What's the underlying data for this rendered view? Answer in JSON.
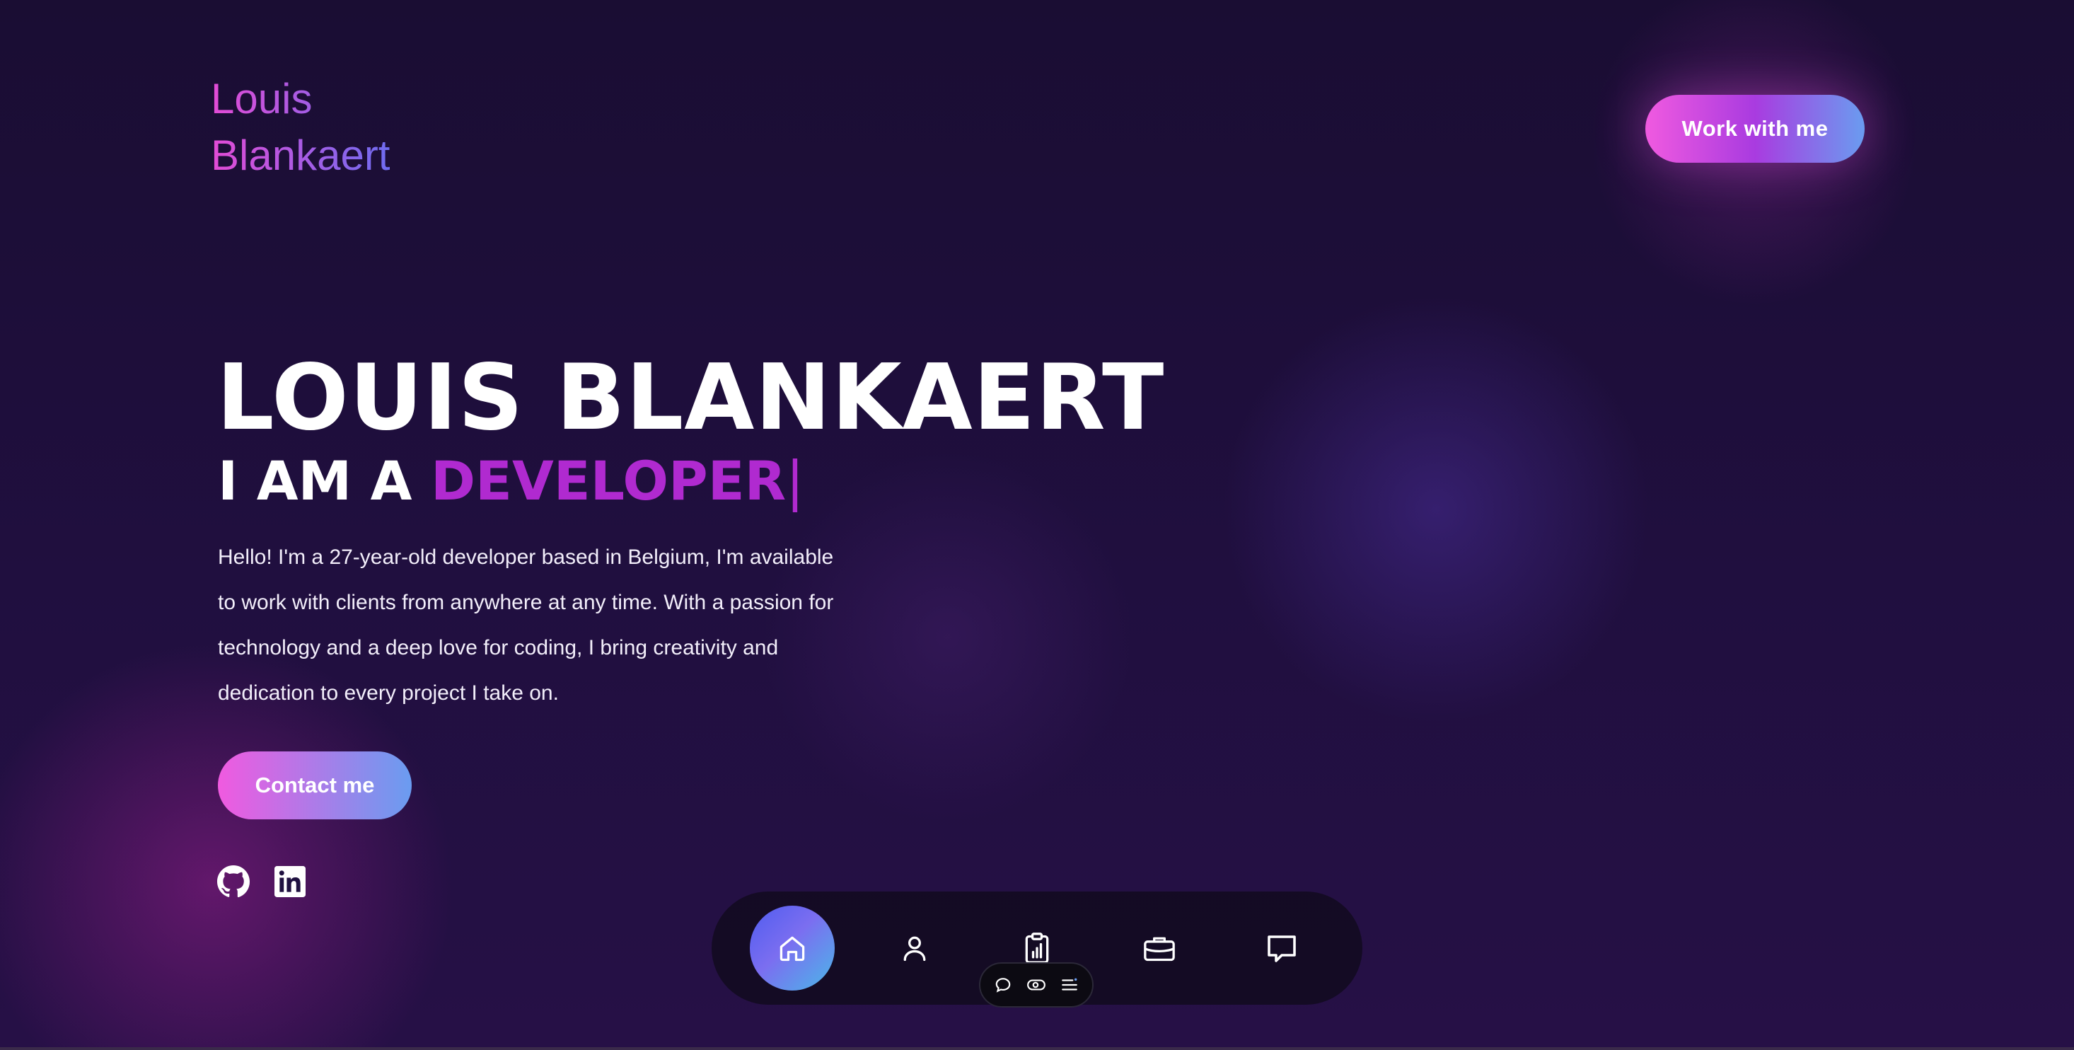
{
  "header": {
    "logo_line1": "Louis",
    "logo_line2": "Blankaert",
    "cta_label": "Work with me"
  },
  "hero": {
    "name": "LOUIS BLANKAERT",
    "role_prefix": "I AM A",
    "role_word": "DEVELOPER",
    "cursor": "|",
    "intro": "Hello! I'm a 27-year-old developer based in Belgium, I'm available to work with clients from anywhere at any time. With a passion for technology and a deep love for coding, I bring creativity and dedication to every project I take on.",
    "contact_label": "Contact me"
  },
  "social": {
    "items": [
      {
        "icon": "github-icon"
      },
      {
        "icon": "linkedin-icon"
      }
    ]
  },
  "dock": {
    "active": "home",
    "items": [
      {
        "icon": "home-icon"
      },
      {
        "icon": "user-icon"
      },
      {
        "icon": "clipboard-chart-icon"
      },
      {
        "icon": "briefcase-icon"
      },
      {
        "icon": "chat-icon"
      }
    ]
  },
  "mini_toolbar": {
    "items": [
      {
        "icon": "comment-icon"
      },
      {
        "icon": "eye-toggle-icon"
      },
      {
        "icon": "list-icon"
      }
    ]
  },
  "colors": {
    "accent_pink": "#f05ae0",
    "accent_blue": "#6a9cf0",
    "role_purple": "#b02ad0",
    "background": "#1c0f3a"
  }
}
